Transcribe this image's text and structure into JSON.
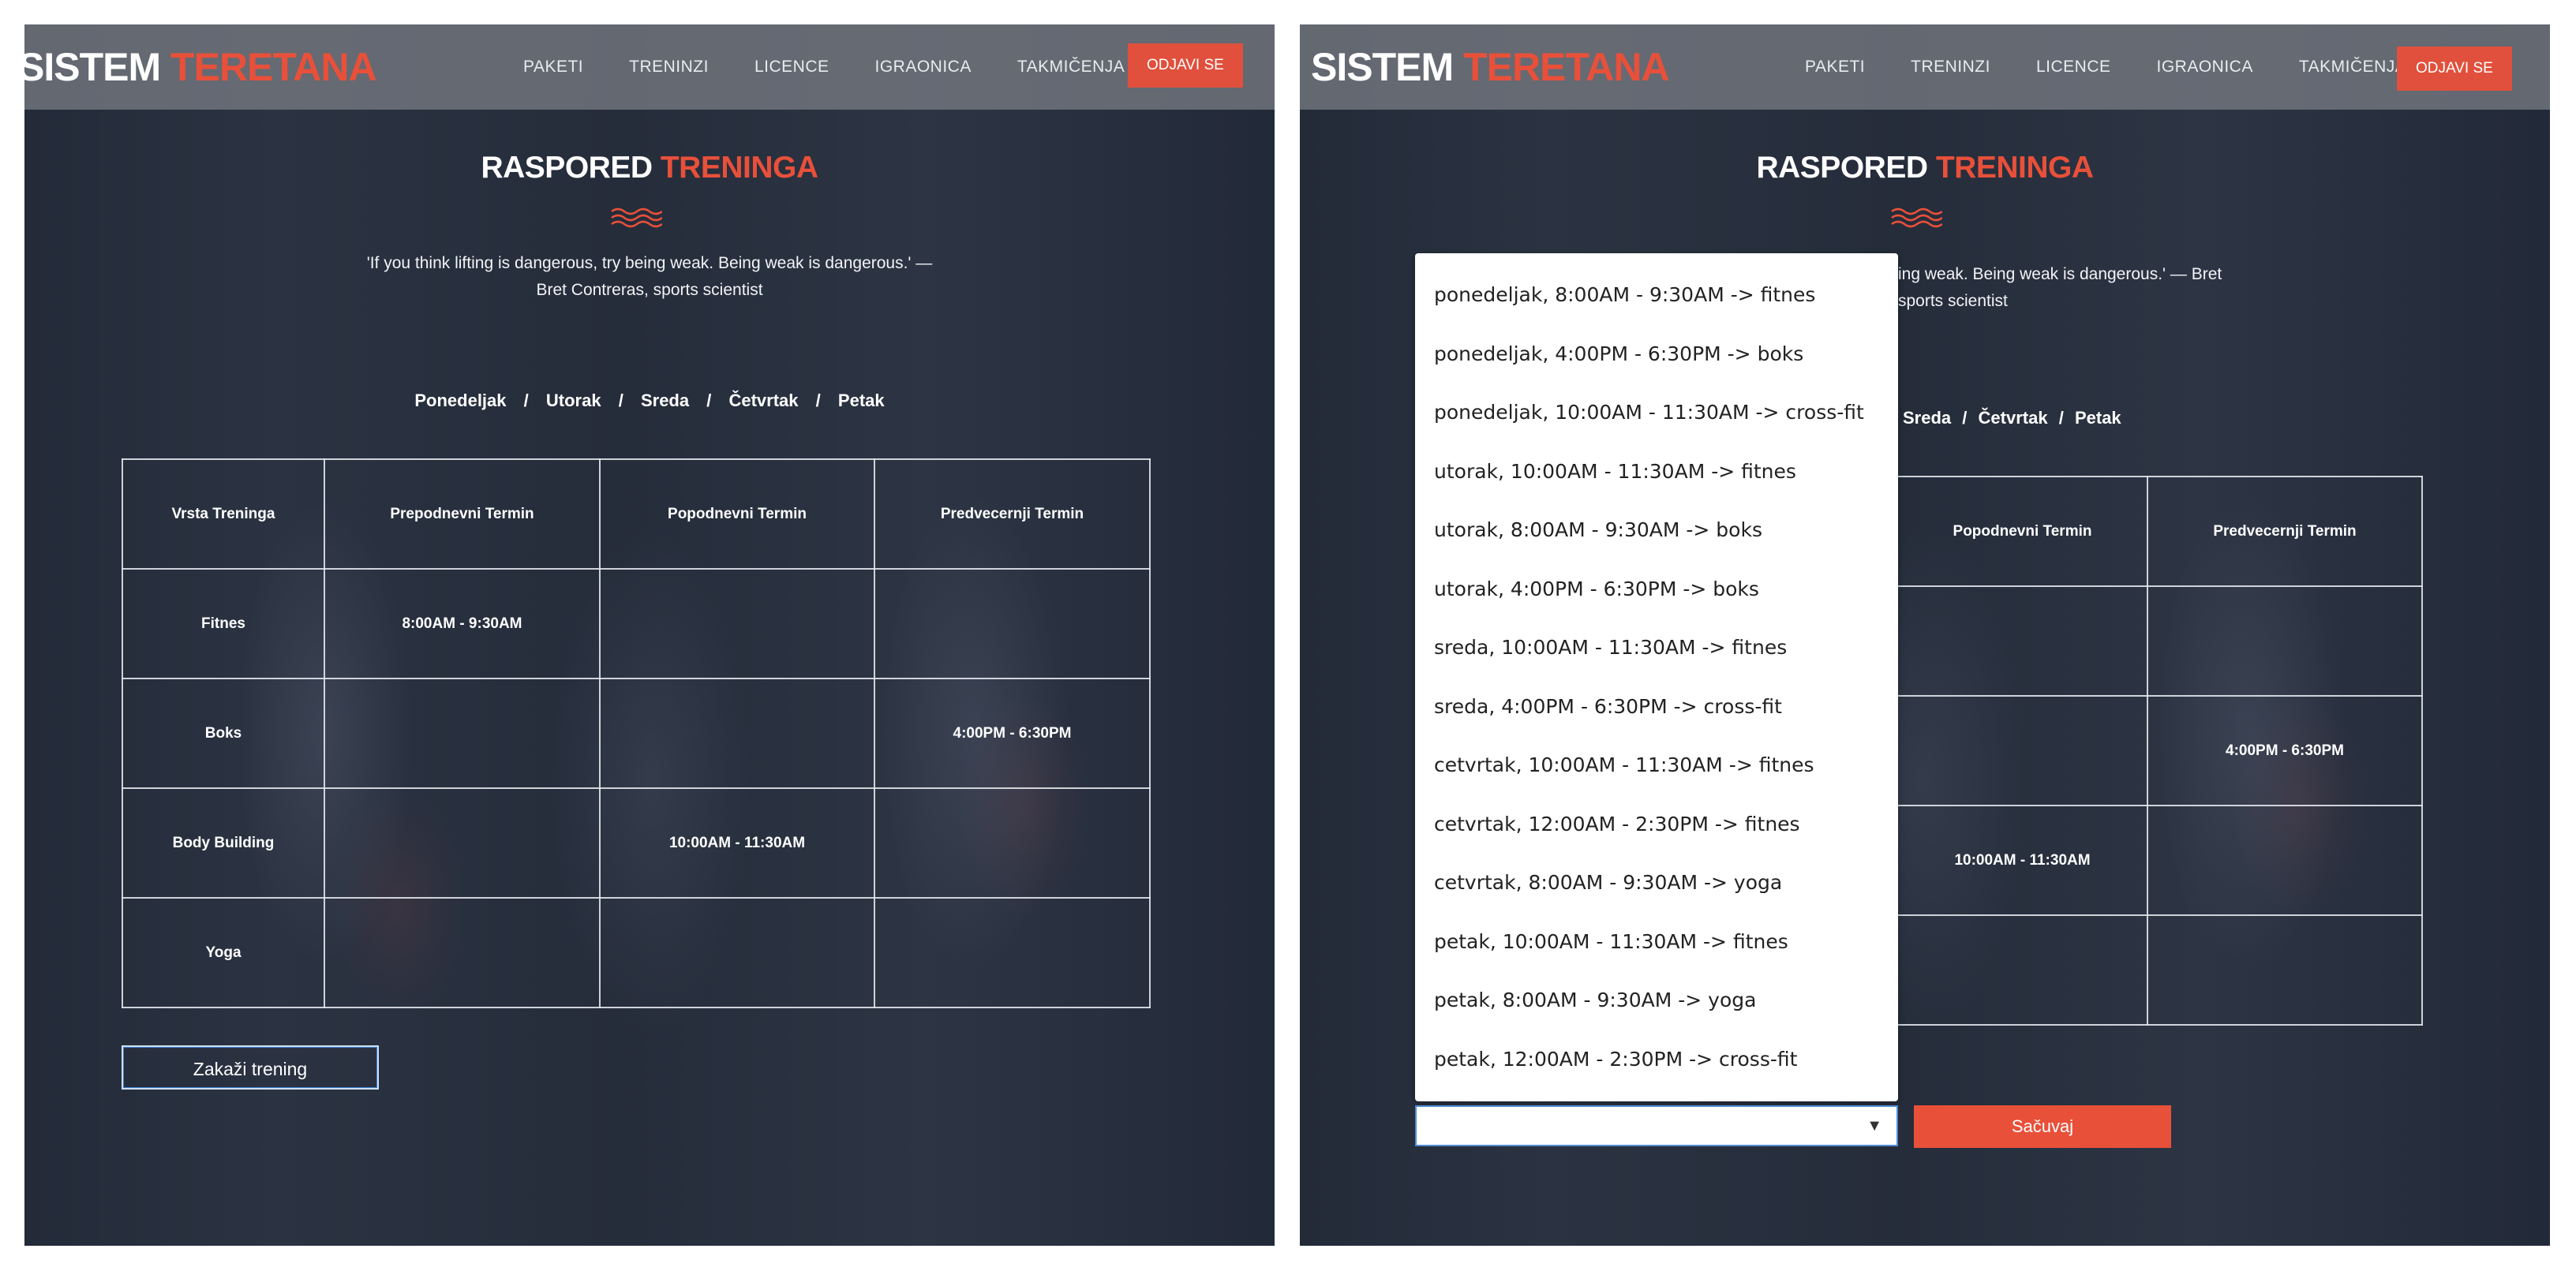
{
  "brand": {
    "part1": "SISTEM",
    "part2": "TERETANA"
  },
  "nav": {
    "items": [
      "PAKETI",
      "TRENINZI",
      "LICENCE",
      "IGRAONICA",
      "TAKMIČENJA"
    ],
    "logout_label": "ODJAVI SE"
  },
  "page": {
    "title_part1": "RASPORED",
    "title_part2": "TRENINGA",
    "quote": "'If you think lifting is dangerous, try being weak. Being weak is dangerous.' — Bret Contreras, sports scientist",
    "days": [
      "Ponedeljak",
      "Utorak",
      "Sreda",
      "Četvrtak",
      "Petak"
    ],
    "days_separator": "/"
  },
  "schedule": {
    "headers": [
      "Vrsta Treninga",
      "Prepodnevni Termin",
      "Popodnevni Termin",
      "Predvecernji Termin"
    ],
    "rows": [
      [
        "Fitnes",
        "8:00AM - 9:30AM",
        "",
        ""
      ],
      [
        "Boks",
        "",
        "",
        "4:00PM - 6:30PM"
      ],
      [
        "Body Building",
        "",
        "10:00AM - 11:30AM",
        ""
      ],
      [
        "Yoga",
        "",
        "",
        ""
      ]
    ]
  },
  "left_panel": {
    "schedule_button_label": "Zakaži trening"
  },
  "right_panel": {
    "quote_visible": "ing weak. Being weak is dangerous.' — Bret",
    "quote_visible_line2": "sports scientist",
    "days_visible": [
      "Sreda",
      "Četvrtak",
      "Petak"
    ],
    "headers_visible": [
      "Popodnevni Termin",
      "Predvecernji Termin"
    ],
    "rows_visible": [
      [
        "",
        ""
      ],
      [
        "",
        "4:00PM - 6:30PM"
      ],
      [
        "10:00AM - 11:30AM",
        ""
      ],
      [
        "",
        ""
      ]
    ],
    "select": {
      "value": "",
      "options": [
        "ponedeljak, 8:00AM - 9:30AM -> fitnes",
        "ponedeljak, 4:00PM - 6:30PM -> boks",
        "ponedeljak, 10:00AM - 11:30AM -> cross-fit",
        "utorak, 10:00AM - 11:30AM -> fitnes",
        "utorak, 8:00AM - 9:30AM -> boks",
        "utorak, 4:00PM - 6:30PM -> boks",
        "sreda, 10:00AM - 11:30AM -> fitnes",
        "sreda, 4:00PM - 6:30PM -> cross-fit",
        "cetvrtak, 10:00AM - 11:30AM -> fitnes",
        "cetvrtak, 12:00AM - 2:30PM -> fitnes",
        "cetvrtak, 8:00AM - 9:30AM -> yoga",
        "petak, 10:00AM - 11:30AM -> fitnes",
        "petak, 8:00AM - 9:30AM -> yoga",
        "petak, 12:00AM - 2:30PM -> cross-fit"
      ]
    },
    "save_label": "Sačuvaj"
  },
  "colors": {
    "accent": "#e8503a",
    "navbar": "#767a82",
    "select_border": "#4f8cd4"
  },
  "icons": {
    "wave": "wave-divider-icon",
    "select_arrow": "chevron-down-icon"
  }
}
